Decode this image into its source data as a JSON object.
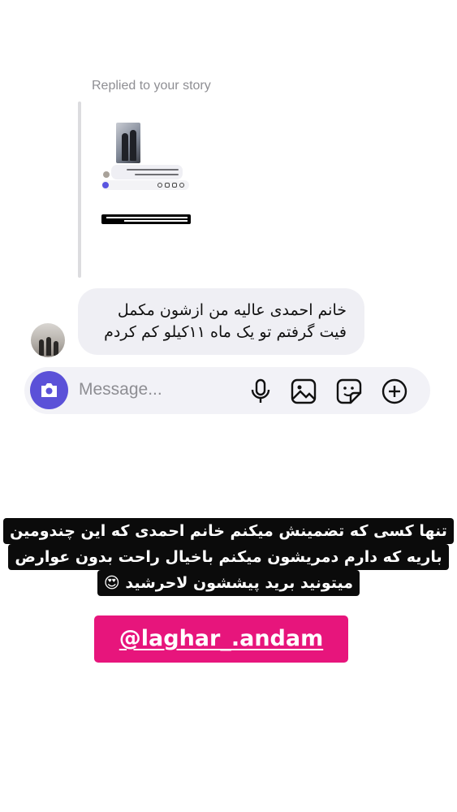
{
  "reply": {
    "label": "Replied to your story"
  },
  "message": {
    "line1": "خانم احمدی  عالیه من ازشون مکمل",
    "line2": "فیت گرفتم تو یک ماه ۱۱کیلو کم کردم"
  },
  "composer": {
    "placeholder": "Message...",
    "icons": [
      "camera-icon",
      "microphone-icon",
      "gallery-icon",
      "sticker-icon",
      "add-icon"
    ],
    "camera_color": "#5b51d8"
  },
  "caption": {
    "line1": "تنها کسی که تضمینش میکنم خانم احمدی که این چندومین",
    "line2": "باریه که دارم دمریشون میکنم باخیال راحت بدون عوارض",
    "line3": "میتونید برید پیششون لاحرشید 😍"
  },
  "mention": {
    "text": "@laghar_.andam",
    "color": "#e7157c"
  }
}
